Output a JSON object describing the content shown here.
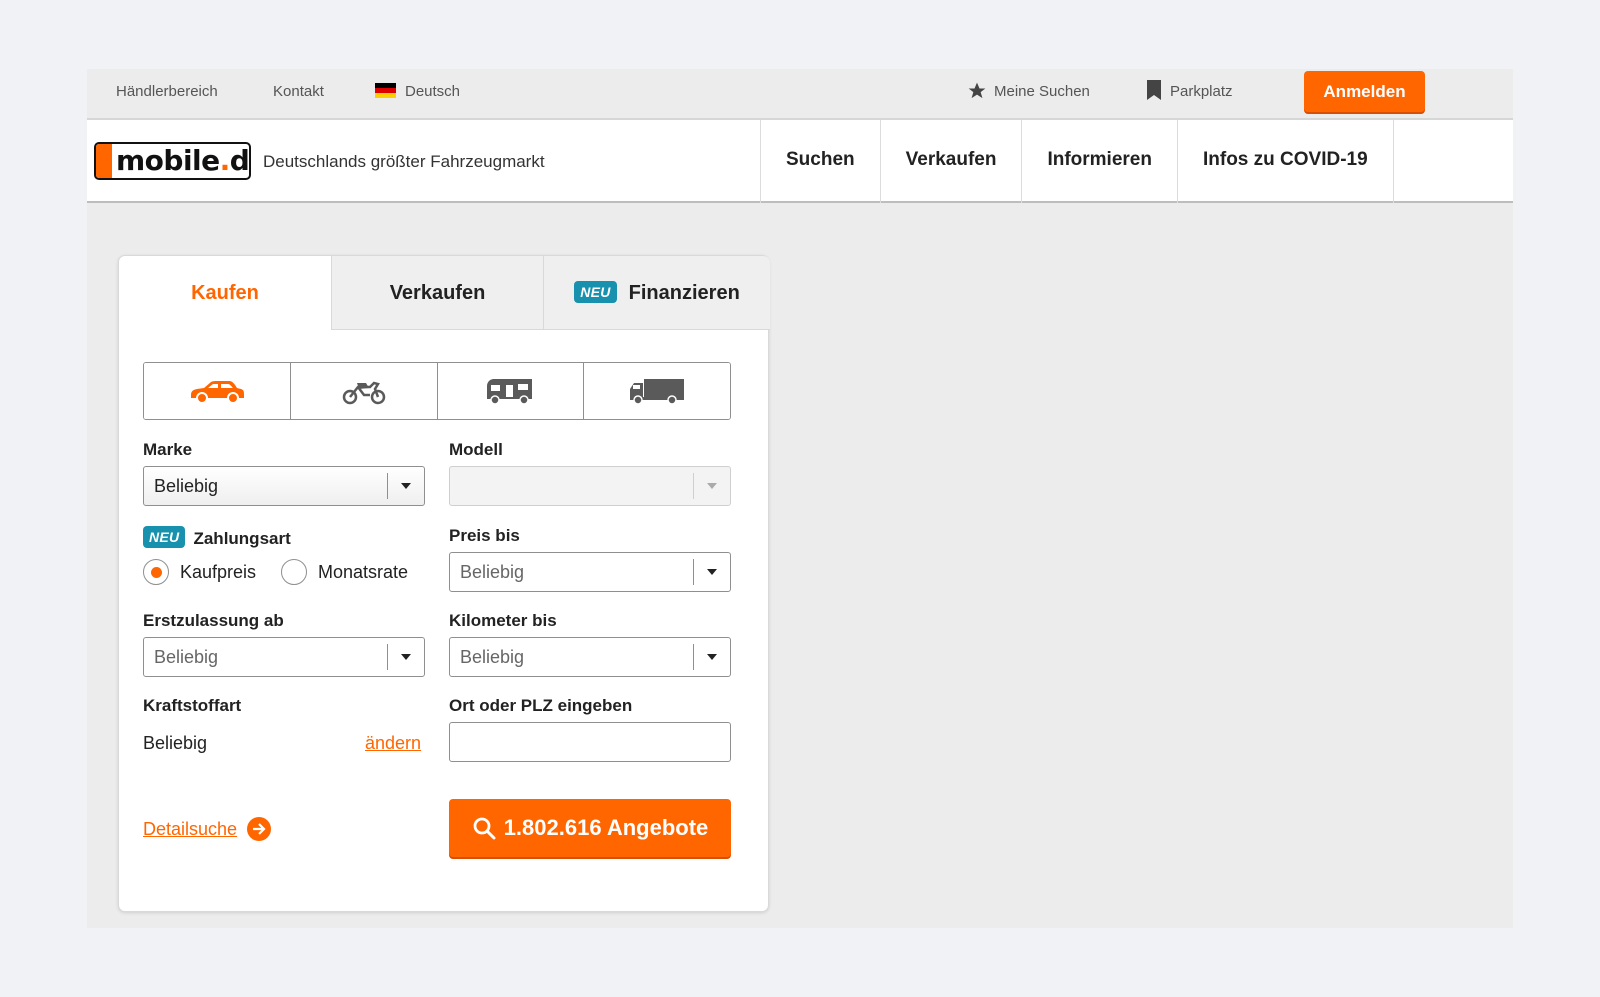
{
  "topbar": {
    "dealer_area": "Händlerbereich",
    "contact": "Kontakt",
    "language": "Deutsch",
    "saved_searches": "Meine Suchen",
    "parking": "Parkplatz",
    "login": "Anmelden"
  },
  "header": {
    "logo_main": "mobile",
    "logo_dot": ".",
    "logo_tld": "de",
    "tagline": "Deutschlands größter Fahrzeugmarkt",
    "nav": [
      "Suchen",
      "Verkaufen",
      "Informieren",
      "Infos zu COVID-19"
    ]
  },
  "search": {
    "tabs": [
      {
        "label": "Kaufen"
      },
      {
        "label": "Verkaufen"
      },
      {
        "label": "Finanzieren",
        "badge": "NEU"
      }
    ],
    "vehicle_types": [
      "car-icon",
      "motorbike-icon",
      "motorhome-icon",
      "truck-icon"
    ],
    "make": {
      "label": "Marke",
      "value": "Beliebig"
    },
    "model": {
      "label": "Modell",
      "value": ""
    },
    "payment": {
      "badge": "NEU",
      "label": "Zahlungsart",
      "options": [
        "Kaufpreis",
        "Monatsrate"
      ],
      "selected": "Kaufpreis"
    },
    "price": {
      "label": "Preis bis",
      "value": "Beliebig"
    },
    "first_registration": {
      "label": "Erstzulassung ab",
      "value": "Beliebig"
    },
    "mileage": {
      "label": "Kilometer bis",
      "value": "Beliebig"
    },
    "fuel": {
      "label": "Kraftstoffart",
      "value": "Beliebig",
      "change": "ändern"
    },
    "location": {
      "label": "Ort oder PLZ eingeben",
      "value": ""
    },
    "detail_search": "Detailsuche",
    "submit": "1.802.616 Angebote"
  },
  "colors": {
    "accent": "#ff6600",
    "badge": "#1791ad"
  }
}
